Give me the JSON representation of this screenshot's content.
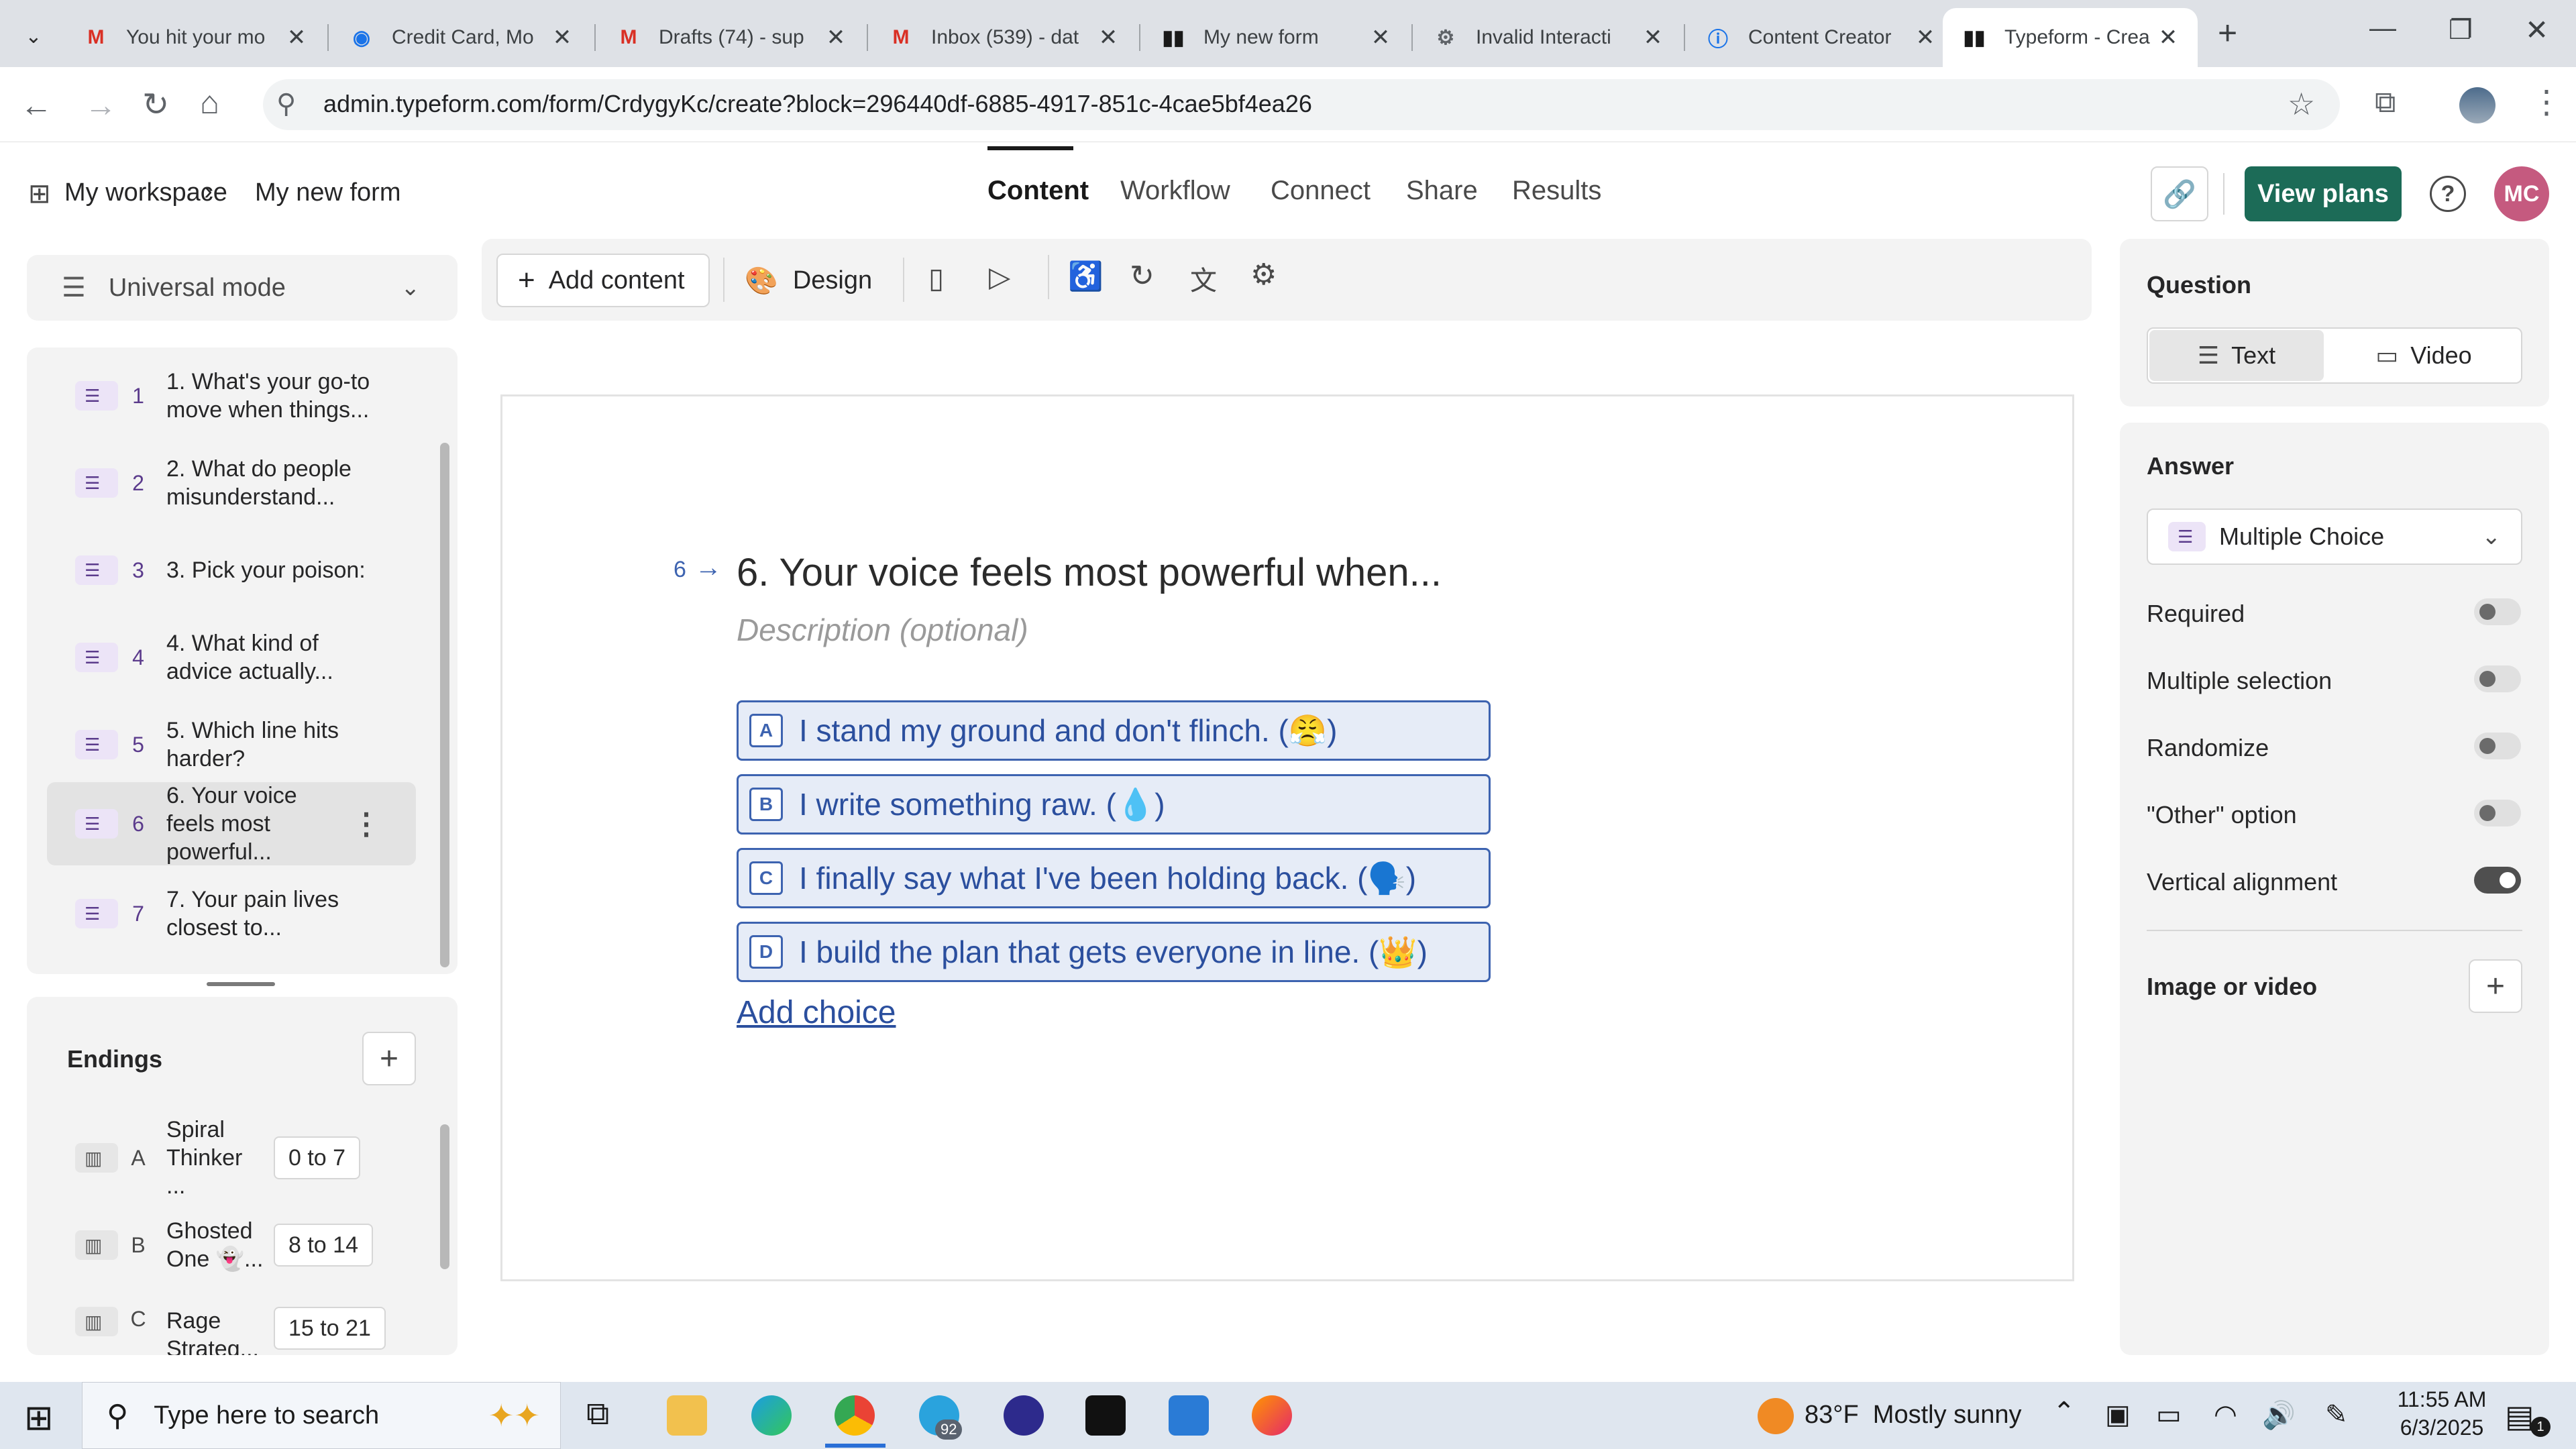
{
  "browser": {
    "tabs": [
      {
        "title": "You hit your mo",
        "favicon": "gmail-icon"
      },
      {
        "title": "Credit Card, Mo",
        "favicon": "globe-icon"
      },
      {
        "title": "Drafts (74) - sup",
        "favicon": "gmail-icon"
      },
      {
        "title": "Inbox (539) - dat",
        "favicon": "gmail-icon"
      },
      {
        "title": "My new form",
        "favicon": "typeform-icon"
      },
      {
        "title": "Invalid Interacti",
        "favicon": "settings-icon"
      },
      {
        "title": "Content Creator",
        "favicon": "info-icon"
      },
      {
        "title": "Typeform - Crea",
        "favicon": "typeform-icon"
      }
    ],
    "url": "admin.typeform.com/form/CrdygyKc/create?block=296440df-6885-4917-851c-4cae5bf4ea26"
  },
  "header": {
    "breadcrumb_workspace": "My workspace",
    "breadcrumb_sep": "›",
    "breadcrumb_form": "My new form",
    "nav": [
      "Content",
      "Workflow",
      "Connect",
      "Share",
      "Results"
    ],
    "view_plans": "View plans",
    "avatar_initials": "MC"
  },
  "sidebar": {
    "mode": "Universal mode",
    "questions": [
      {
        "num": "1",
        "title": "1. What's your go-to move when things..."
      },
      {
        "num": "2",
        "title": "2. What do people misunderstand..."
      },
      {
        "num": "3",
        "title": "3. Pick your poison:"
      },
      {
        "num": "4",
        "title": "4. What kind of advice actually..."
      },
      {
        "num": "5",
        "title": "5. Which line hits harder?"
      },
      {
        "num": "6",
        "title": "6. Your voice feels most powerful..."
      },
      {
        "num": "7",
        "title": "7. Your pain lives closest to..."
      }
    ],
    "endings_title": "Endings",
    "endings": [
      {
        "key": "A",
        "title": "Spiral Thinker ...",
        "range": "0 to 7"
      },
      {
        "key": "B",
        "title": "Ghosted One 👻...",
        "range": "8 to 14"
      },
      {
        "key": "C",
        "title": "Rage Strateg...",
        "range": "15 to 21"
      }
    ]
  },
  "toolbar": {
    "add_content": "Add content",
    "design": "Design"
  },
  "canvas": {
    "question_number": "6",
    "question_title": "6. Your voice feels most powerful when...",
    "description_placeholder": "Description (optional)",
    "choices": [
      {
        "key": "A",
        "text": "I stand my ground and don't flinch. (😤)"
      },
      {
        "key": "B",
        "text": "I write something raw. (💧)"
      },
      {
        "key": "C",
        "text": "I finally say what I've been holding back. (🗣️)"
      },
      {
        "key": "D",
        "text": "I build the plan that gets everyone in line. (👑)"
      }
    ],
    "add_choice": "Add choice"
  },
  "settings": {
    "question_heading": "Question",
    "text_tab": "Text",
    "video_tab": "Video",
    "answer_heading": "Answer",
    "answer_type": "Multiple Choice",
    "rows": [
      {
        "label": "Required",
        "on": false
      },
      {
        "label": "Multiple selection",
        "on": false
      },
      {
        "label": "Randomize",
        "on": false
      },
      {
        "label": "\"Other\" option",
        "on": false
      },
      {
        "label": "Vertical alignment",
        "on": true
      }
    ],
    "image_or_video": "Image or video"
  },
  "taskbar": {
    "search_placeholder": "Type here to search",
    "weather": "83°F  Mostly sunny",
    "time": "11:55 AM",
    "date": "6/3/2025",
    "telegram_badge": "92",
    "notification_count": "1"
  },
  "colors": {
    "accent_green": "#1c6b57",
    "choice_blue": "#3d63b0",
    "choice_bg": "#e6ecf7",
    "question_icon_bg": "#ece4f7"
  }
}
